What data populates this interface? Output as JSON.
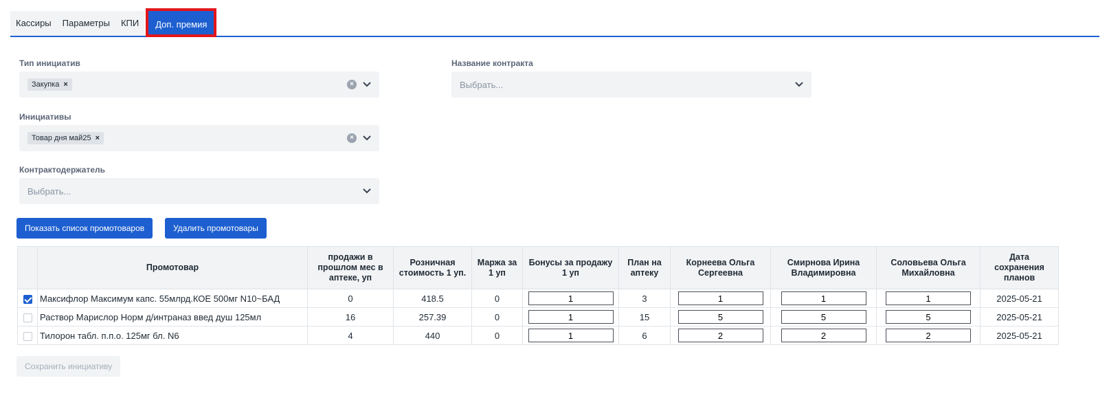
{
  "tabs": [
    {
      "label": "Кассиры",
      "active": false
    },
    {
      "label": "Параметры",
      "active": false
    },
    {
      "label": "КПИ",
      "active": false
    },
    {
      "label": "Доп. премия",
      "active": true
    }
  ],
  "filters": {
    "initiative_type": {
      "label": "Тип инициатив",
      "chips": [
        "Закупка"
      ]
    },
    "initiatives": {
      "label": "Инициативы",
      "chips": [
        "Товар дня май25"
      ]
    },
    "contract_holder": {
      "label": "Контрактодержатель",
      "placeholder": "Выбрать..."
    },
    "contract_name": {
      "label": "Название контракта",
      "placeholder": "Выбрать..."
    }
  },
  "buttons": {
    "show_list": "Показать список промотоваров",
    "delete_items": "Удалить промотовары",
    "save_initiative": "Сохранить инициативу"
  },
  "table": {
    "headers": [
      "",
      "Промотовар",
      "продажи в прошлом мес в аптеке, уп",
      "Розничная стоимость 1 уп.",
      "Маржа за 1 уп",
      "Бонусы за продажу 1 уп",
      "План на аптеку",
      "Корнеева Ольга Сергеевна",
      "Смирнова Ирина Владимировна",
      "Соловьева Ольга Михайловна",
      "Дата сохранения планов"
    ],
    "rows": [
      {
        "checked": true,
        "name": "Максифлор Максимум капс. 55млрд.КОЕ 500мг N10~БАД",
        "sales": "0",
        "price": "418.5",
        "margin": "0",
        "bonus": "1",
        "plan": "3",
        "k1": "1",
        "k2": "1",
        "k3": "1",
        "date": "2025-05-21"
      },
      {
        "checked": false,
        "name": "Раствор Марислор Норм д/интраназ введ душ 125мл",
        "sales": "16",
        "price": "257.39",
        "margin": "0",
        "bonus": "1",
        "plan": "15",
        "k1": "5",
        "k2": "5",
        "k3": "5",
        "date": "2025-05-21"
      },
      {
        "checked": false,
        "name": "Тилорон табл. п.п.о. 125мг бл. N6",
        "sales": "4",
        "price": "440",
        "margin": "0",
        "bonus": "1",
        "plan": "6",
        "k1": "2",
        "k2": "2",
        "k3": "2",
        "date": "2025-05-21"
      }
    ]
  },
  "colors": {
    "accent": "#1d5fd0",
    "highlight_border": "#e3161b",
    "field_bg": "#f1f3f5"
  }
}
